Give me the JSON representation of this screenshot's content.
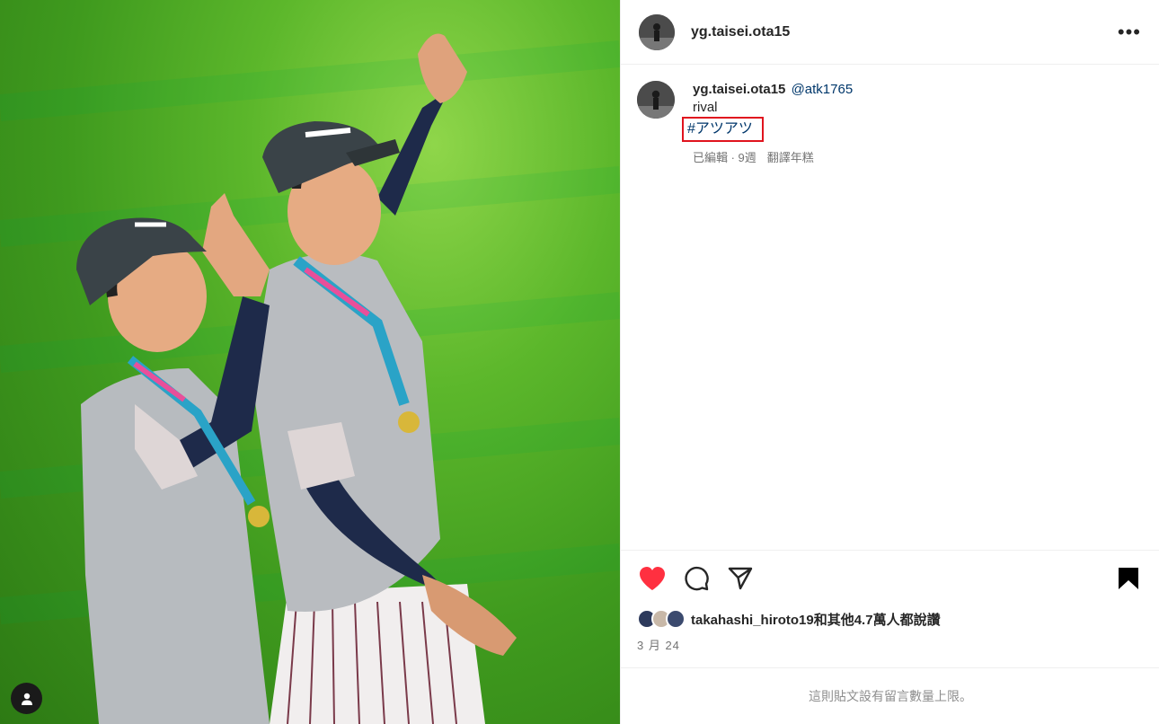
{
  "post": {
    "author": "yg.taisei.ota15",
    "more_label": "•••",
    "caption": {
      "author": "yg.taisei.ota15",
      "mention": "@atk1765",
      "text": "rival",
      "hashtag": "#アツアツ",
      "meta": "已編輯 · 9週",
      "translate": "翻譯年糕"
    },
    "likes_text": "takahashi_hiroto19和其他4.7萬人都說讚",
    "date": "3 月 24",
    "comments_limited": "這則貼文設有留言數量上限。"
  },
  "colors": {
    "like_red": "#ff3040",
    "link_blue": "#00376b",
    "highlight_box": "#e0141e"
  },
  "icons": {
    "like": "heart-filled-icon",
    "comment": "comment-icon",
    "share": "paper-plane-icon",
    "save": "bookmark-filled-icon",
    "more": "more-dots-icon",
    "user_tags": "user-icon"
  }
}
